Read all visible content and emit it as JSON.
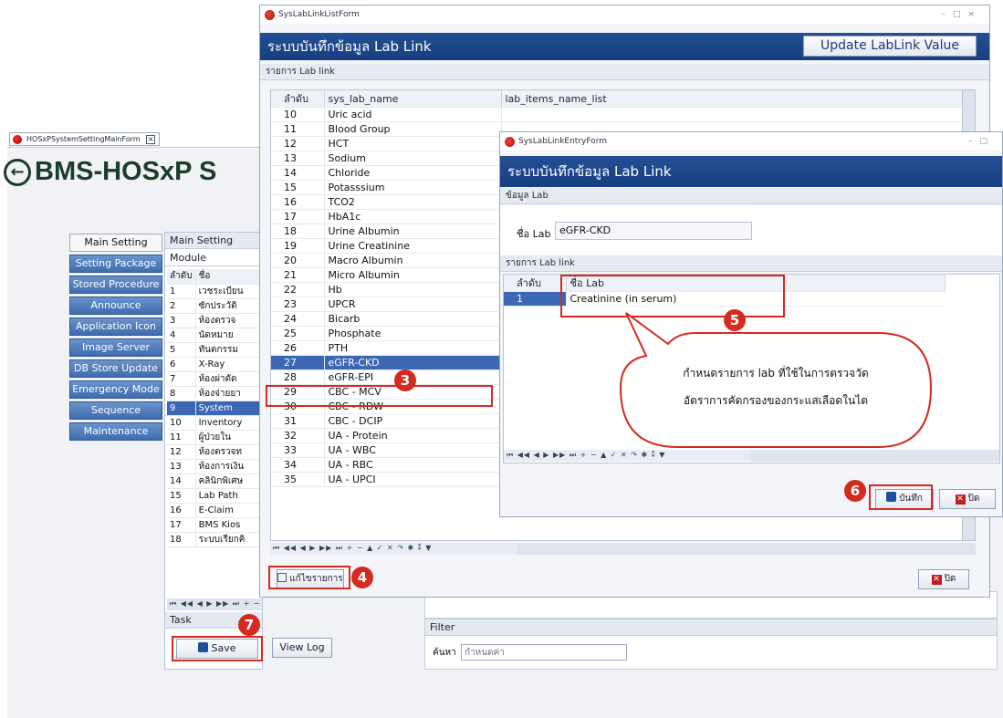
{
  "main_window": {
    "tab_title": "HOSxPSystemSettingMainForm",
    "brand": "BMS-HOSxP S",
    "nav": [
      "Main Setting",
      "Setting Package",
      "Stored Procedure",
      "Announce",
      "Application Icon",
      "Image Server",
      "DB Store Update",
      "Emergency Mode",
      "Sequence",
      "Maintenance"
    ],
    "panel_title": "Main Setting",
    "module_label": "Module",
    "grid_headers": [
      "ลำดับ",
      "ชื่อ"
    ],
    "modules": [
      {
        "n": "1",
        "name": "เวชระเบียน"
      },
      {
        "n": "2",
        "name": "ซักประวัติ"
      },
      {
        "n": "3",
        "name": "ห้องตรวจ"
      },
      {
        "n": "4",
        "name": "นัดหมาย"
      },
      {
        "n": "5",
        "name": "ทันตกรรม"
      },
      {
        "n": "6",
        "name": "X-Ray"
      },
      {
        "n": "7",
        "name": "ห้องผ่าตัด"
      },
      {
        "n": "8",
        "name": "ห้องจ่ายยา"
      },
      {
        "n": "9",
        "name": "System"
      },
      {
        "n": "10",
        "name": "Inventory"
      },
      {
        "n": "11",
        "name": "ผู้ป่วยใน"
      },
      {
        "n": "12",
        "name": "ห้องตรวจท"
      },
      {
        "n": "13",
        "name": "ห้องการเงิน"
      },
      {
        "n": "14",
        "name": "คลินิกพิเศษ"
      },
      {
        "n": "15",
        "name": "Lab Path"
      },
      {
        "n": "16",
        "name": "E-Claim"
      },
      {
        "n": "17",
        "name": "BMS Kios"
      },
      {
        "n": "18",
        "name": "ระบบเรียกคิ"
      }
    ],
    "task_label": "Task",
    "save_button": "Save",
    "viewlog_button": "View Log",
    "filter_label": "Filter",
    "search_label": "ค้นหา",
    "search_placeholder": "กำหนดค่า"
  },
  "list_form": {
    "window_title": "SysLabLinkListForm",
    "header": "ระบบบันทึกข้อมูล Lab Link",
    "update_button": "Update LabLink Value",
    "section": "รายการ Lab link",
    "columns": [
      "ลำดับ",
      "sys_lab_name",
      "lab_items_name_list"
    ],
    "rows": [
      {
        "n": "10",
        "name": "Uric acid"
      },
      {
        "n": "11",
        "name": "Blood Group"
      },
      {
        "n": "12",
        "name": "HCT"
      },
      {
        "n": "13",
        "name": "Sodium"
      },
      {
        "n": "14",
        "name": "Chloride"
      },
      {
        "n": "15",
        "name": "Potasssium"
      },
      {
        "n": "16",
        "name": "TCO2"
      },
      {
        "n": "17",
        "name": "HbA1c"
      },
      {
        "n": "18",
        "name": "Urine Albumin"
      },
      {
        "n": "19",
        "name": "Urine Creatinine"
      },
      {
        "n": "20",
        "name": "Macro Albumin"
      },
      {
        "n": "21",
        "name": "Micro Albumin"
      },
      {
        "n": "22",
        "name": "Hb"
      },
      {
        "n": "23",
        "name": "UPCR"
      },
      {
        "n": "24",
        "name": "Bicarb"
      },
      {
        "n": "25",
        "name": "Phosphate"
      },
      {
        "n": "26",
        "name": "PTH"
      },
      {
        "n": "27",
        "name": "eGFR-CKD"
      },
      {
        "n": "28",
        "name": "eGFR-EPI"
      },
      {
        "n": "29",
        "name": "CBC - MCV"
      },
      {
        "n": "30",
        "name": "CBC - RDW"
      },
      {
        "n": "31",
        "name": "CBC - DCIP"
      },
      {
        "n": "32",
        "name": "UA - Protein"
      },
      {
        "n": "33",
        "name": "UA - WBC"
      },
      {
        "n": "34",
        "name": "UA - RBC"
      },
      {
        "n": "35",
        "name": "UA - UPCI"
      }
    ],
    "edit_button": "แก้ไขรายการ",
    "close_button": "ปิด"
  },
  "entry_form": {
    "window_title": "SysLabLinkEntryForm",
    "header": "ระบบบันทึกข้อมูล Lab Link",
    "lab_section": "ข้อมูล Lab",
    "lab_name_label": "ชื่อ Lab",
    "lab_name_value": "eGFR-CKD",
    "link_section": "รายการ Lab link",
    "columns": [
      "ลำดับ",
      "ชื่อ Lab"
    ],
    "rows": [
      {
        "n": "1",
        "name": "Creatinine (in serum)"
      }
    ],
    "save_button": "บันทึก",
    "close_button": "ปิด"
  },
  "callout": {
    "line1": "กำหนดรายการ lab ที่ใช้ในการตรวจวัด",
    "line2": "อัตราการคัดกรองของกระแสเลือดในไต"
  },
  "steps": [
    "3",
    "4",
    "5",
    "6",
    "7"
  ],
  "colors": {
    "header_blue": "#1c4589",
    "selection_blue": "#3b67b4",
    "callout_red": "#d42a1f"
  }
}
